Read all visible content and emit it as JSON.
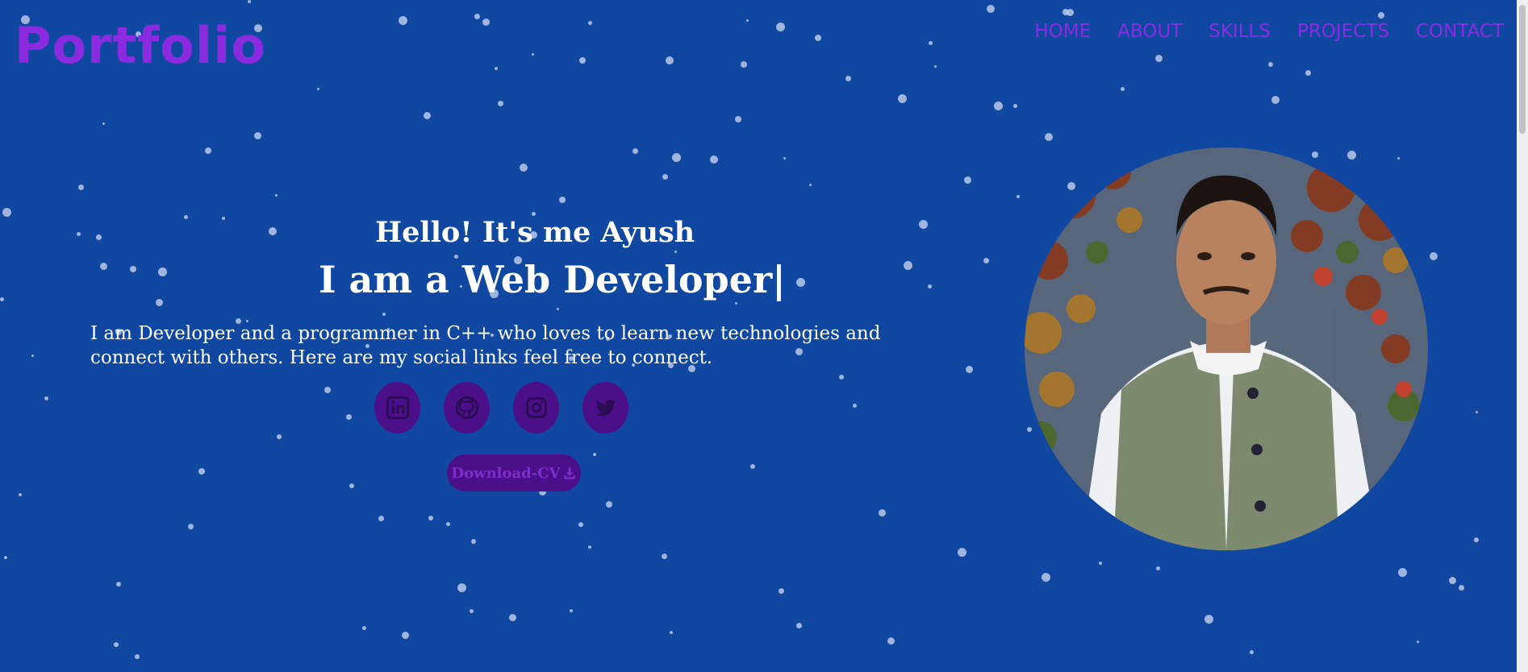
{
  "logo": "Portfolio",
  "nav": [
    "HOME",
    "ABOUT",
    "SKILLS",
    "PROJECTS",
    "CONTACT"
  ],
  "hero": {
    "greeting": "Hello! It's me Ayush",
    "role": "I am a Web Developer|",
    "description": "I am Developer and a programmer in C++ who loves to learn new technologies and connect with others. Here are my social links feel free to connect."
  },
  "socials": [
    "linkedin-icon",
    "github-icon",
    "instagram-icon",
    "twitter-icon"
  ],
  "cv_button": "Download-CV",
  "colors": {
    "background": "#0f47a1",
    "accent": "#8a2be2",
    "button": "#4b0f8a",
    "star": "#b9c9e8"
  }
}
